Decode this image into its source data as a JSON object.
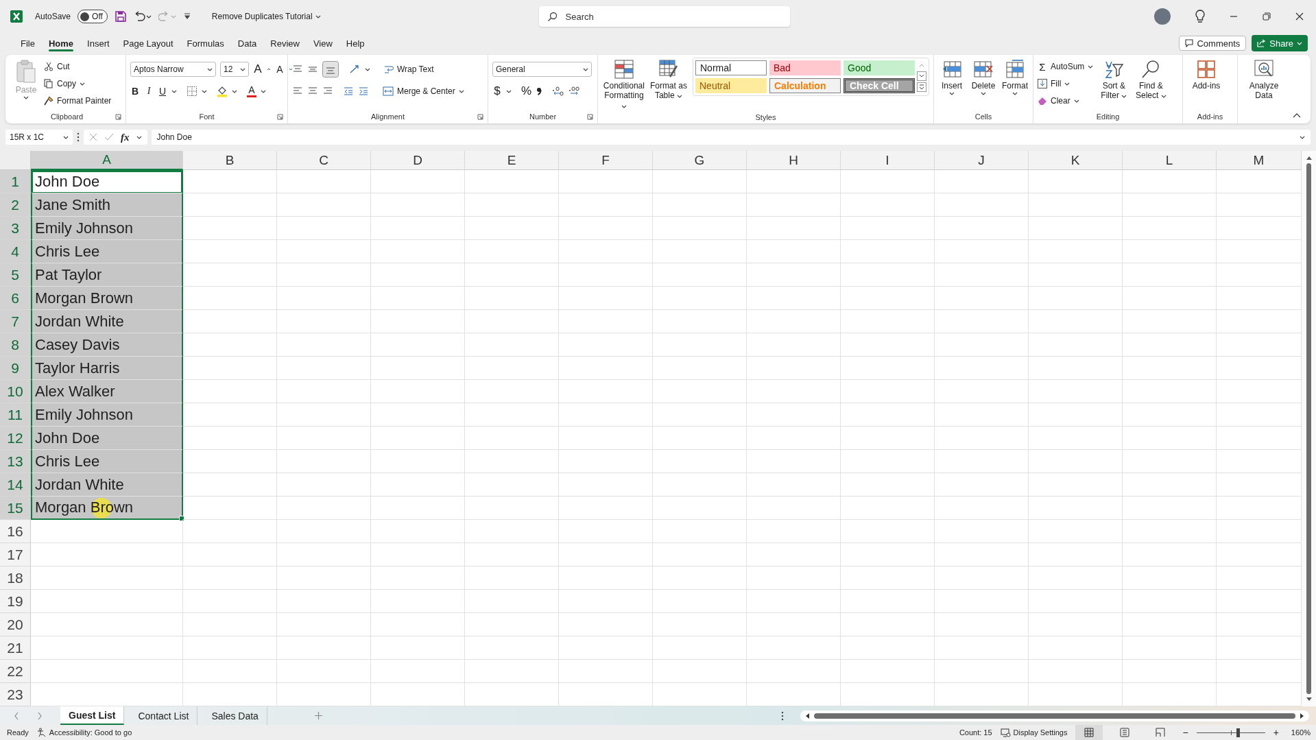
{
  "title_bar": {
    "autosave": {
      "label": "AutoSave",
      "on": false,
      "state_text": "Off"
    },
    "document_title": "Remove Duplicates Tutorial",
    "search": {
      "placeholder": "Search"
    }
  },
  "menu_tabs": [
    {
      "label": "File",
      "selected": false
    },
    {
      "label": "Home",
      "selected": true
    },
    {
      "label": "Insert",
      "selected": false
    },
    {
      "label": "Page Layout",
      "selected": false
    },
    {
      "label": "Formulas",
      "selected": false
    },
    {
      "label": "Data",
      "selected": false
    },
    {
      "label": "Review",
      "selected": false
    },
    {
      "label": "View",
      "selected": false
    },
    {
      "label": "Help",
      "selected": false
    }
  ],
  "header_buttons": {
    "comments": "Comments",
    "share": "Share"
  },
  "ribbon": {
    "clipboard": {
      "label": "Clipboard",
      "paste": "Paste",
      "cut": "Cut",
      "copy": "Copy",
      "format_painter": "Format Painter"
    },
    "font": {
      "label": "Font",
      "family": "Aptos Narrow",
      "size": "12",
      "grow": "A",
      "shrink": "A",
      "bold": "B",
      "italic": "I",
      "underline": "U",
      "font_color": "A"
    },
    "alignment": {
      "label": "Alignment",
      "wrap_text": "Wrap Text",
      "merge_center": "Merge & Center"
    },
    "number": {
      "label": "Number",
      "format": "General",
      "currency": "$",
      "percent": "%"
    },
    "styles": {
      "label": "Styles",
      "conditional": "Conditional Formatting",
      "format_table": "Format as Table",
      "gallery": [
        {
          "label": "Normal",
          "kind": "normal"
        },
        {
          "label": "Bad",
          "kind": "bad"
        },
        {
          "label": "Good",
          "kind": "good"
        },
        {
          "label": "Neutral",
          "kind": "neutral"
        },
        {
          "label": "Calculation",
          "kind": "calculation"
        },
        {
          "label": "Check Cell",
          "kind": "check"
        }
      ]
    },
    "cells": {
      "label": "Cells",
      "buttons": [
        {
          "label": "Insert",
          "kind": "insert"
        },
        {
          "label": "Delete",
          "kind": "delete"
        },
        {
          "label": "Format",
          "kind": "format"
        }
      ]
    },
    "editing": {
      "label": "Editing",
      "sigma": "Σ",
      "autosum": "AutoSum",
      "fill": "Fill",
      "clear": "Clear",
      "sort_filter": "Sort & Filter",
      "find_select": "Find & Select"
    },
    "addins": {
      "label": "Add-ins",
      "button": "Add-ins"
    },
    "analyze": {
      "button": "Analyze Data"
    }
  },
  "formula_bar": {
    "name_box": "15R x 1C",
    "fx": "fx",
    "value": "John Doe"
  },
  "sheet": {
    "columns": [
      {
        "label": "A",
        "selected": true
      },
      {
        "label": "B",
        "selected": false
      },
      {
        "label": "C",
        "selected": false
      },
      {
        "label": "D",
        "selected": false
      },
      {
        "label": "E",
        "selected": false
      },
      {
        "label": "F",
        "selected": false
      },
      {
        "label": "G",
        "selected": false
      },
      {
        "label": "H",
        "selected": false
      },
      {
        "label": "I",
        "selected": false
      },
      {
        "label": "J",
        "selected": false
      },
      {
        "label": "K",
        "selected": false
      },
      {
        "label": "L",
        "selected": false
      },
      {
        "label": "M",
        "selected": false
      }
    ],
    "rows": [
      {
        "number": "1",
        "cell_a": "John Doe",
        "selected": true,
        "active": true
      },
      {
        "number": "2",
        "cell_a": "Jane Smith",
        "selected": true,
        "active": false
      },
      {
        "number": "3",
        "cell_a": "Emily Johnson",
        "selected": true,
        "active": false
      },
      {
        "number": "4",
        "cell_a": "Chris Lee",
        "selected": true,
        "active": false
      },
      {
        "number": "5",
        "cell_a": "Pat Taylor",
        "selected": true,
        "active": false
      },
      {
        "number": "6",
        "cell_a": "Morgan Brown",
        "selected": true,
        "active": false
      },
      {
        "number": "7",
        "cell_a": "Jordan White",
        "selected": true,
        "active": false
      },
      {
        "number": "8",
        "cell_a": "Casey Davis",
        "selected": true,
        "active": false
      },
      {
        "number": "9",
        "cell_a": "Taylor Harris",
        "selected": true,
        "active": false
      },
      {
        "number": "10",
        "cell_a": "Alex Walker",
        "selected": true,
        "active": false
      },
      {
        "number": "11",
        "cell_a": "Emily Johnson",
        "selected": true,
        "active": false
      },
      {
        "number": "12",
        "cell_a": "John Doe",
        "selected": true,
        "active": false
      },
      {
        "number": "13",
        "cell_a": "Chris Lee",
        "selected": true,
        "active": false
      },
      {
        "number": "14",
        "cell_a": "Jordan White",
        "selected": true,
        "active": false
      },
      {
        "number": "15",
        "cell_a": "Morgan Brown",
        "selected": true,
        "active": false
      },
      {
        "number": "16",
        "selected": false,
        "active": false
      },
      {
        "number": "17",
        "selected": false,
        "active": false
      },
      {
        "number": "18",
        "selected": false,
        "active": false
      },
      {
        "number": "19",
        "selected": false,
        "active": false
      },
      {
        "number": "20",
        "selected": false,
        "active": false
      },
      {
        "number": "21",
        "selected": false,
        "active": false
      },
      {
        "number": "22",
        "selected": false,
        "active": false
      },
      {
        "number": "23",
        "selected": false,
        "active": false
      }
    ]
  },
  "sheet_tabs": [
    {
      "label": "Guest List",
      "selected": true
    },
    {
      "label": "Contact List",
      "selected": false
    },
    {
      "label": "Sales Data",
      "selected": false
    }
  ],
  "status_bar": {
    "ready": "Ready",
    "accessibility": "Accessibility: Good to go",
    "count": "Count: 15",
    "display_settings": "Display Settings",
    "view_buttons": [
      {
        "kind": "normal",
        "selected": true
      },
      {
        "kind": "page_layout",
        "selected": false
      },
      {
        "kind": "page_break",
        "selected": false
      }
    ],
    "zoom_out": "−",
    "zoom_in": "+",
    "zoom": {
      "level": 0.6
    },
    "zoom_percent": "160%"
  }
}
